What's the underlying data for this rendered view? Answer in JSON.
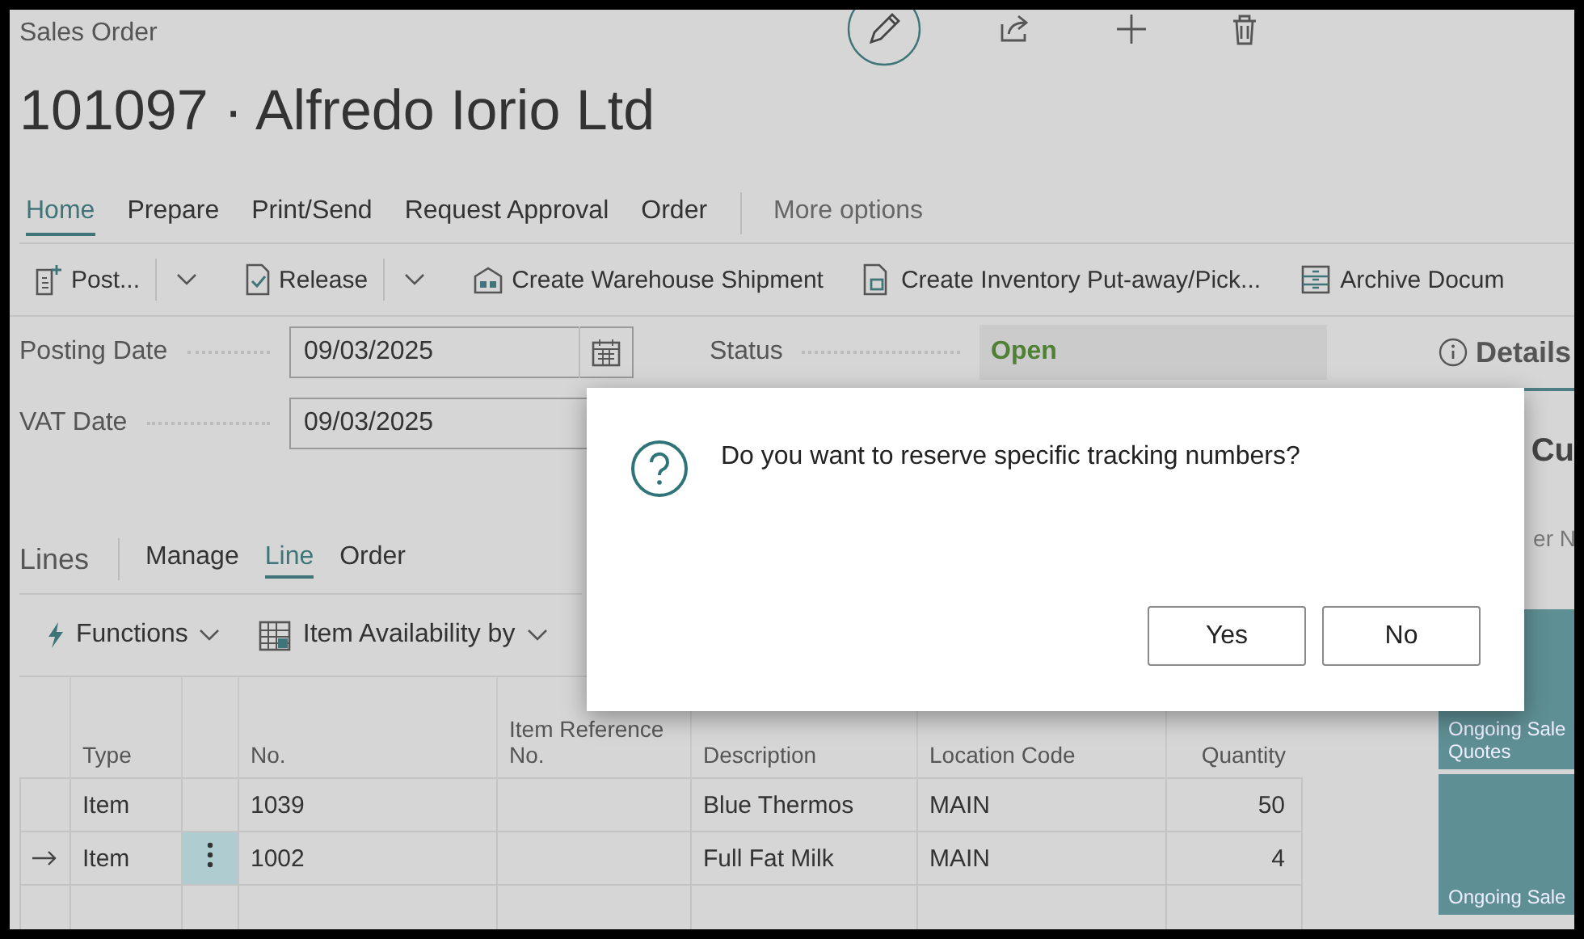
{
  "page": {
    "caption": "Sales Order",
    "title": "101097 · Alfredo Iorio Ltd"
  },
  "menu_tabs": [
    {
      "label": "Home",
      "selected": true
    },
    {
      "label": "Prepare",
      "selected": false
    },
    {
      "label": "Print/Send",
      "selected": false
    },
    {
      "label": "Request Approval",
      "selected": false
    },
    {
      "label": "Order",
      "selected": false
    }
  ],
  "more_options": "More options",
  "actions": [
    {
      "label": "Post...",
      "kind": "post",
      "dropdown": true
    },
    {
      "label": "Release",
      "kind": "release",
      "dropdown": true
    },
    {
      "label": "Create Warehouse Shipment",
      "kind": "warehouse",
      "dropdown": false
    },
    {
      "label": "Create Inventory Put-away/Pick...",
      "kind": "inventory",
      "dropdown": false
    },
    {
      "label": "Archive Docum",
      "kind": "archive",
      "dropdown": false
    }
  ],
  "fields": [
    {
      "label": "Posting Date",
      "value": "09/03/2025",
      "calendar": true
    },
    {
      "label": "VAT Date",
      "value": "09/03/2025",
      "calendar": false
    }
  ],
  "status": {
    "label": "Status",
    "value": "Open"
  },
  "lines": {
    "title": "Lines",
    "tabs": [
      {
        "label": "Manage",
        "selected": false
      },
      {
        "label": "Line",
        "selected": true
      },
      {
        "label": "Order",
        "selected": false
      }
    ],
    "actions": [
      {
        "label": "Functions",
        "kind": "functions"
      },
      {
        "label": "Item Availability by",
        "kind": "availability"
      }
    ],
    "table": {
      "columns": [
        "Type",
        "No.",
        "Item Reference No.",
        "Description",
        "Location Code",
        "Quantity"
      ],
      "rows": [
        {
          "current": false,
          "cells": [
            "Item",
            "1039",
            "",
            "Blue Thermos",
            "MAIN",
            "50"
          ]
        },
        {
          "current": true,
          "cells": [
            "Item",
            "1002",
            "",
            "Full Fat Milk",
            "MAIN",
            "4"
          ]
        }
      ]
    }
  },
  "factbox": {
    "tab": "Details",
    "heading": "Cu",
    "subtext": "er N",
    "tiles": [
      "Ongoing Sale Quotes",
      "Ongoing Sale"
    ]
  },
  "dialog": {
    "message": "Do you want to reserve specific tracking numbers?",
    "buttons": [
      "Yes",
      "No"
    ]
  }
}
